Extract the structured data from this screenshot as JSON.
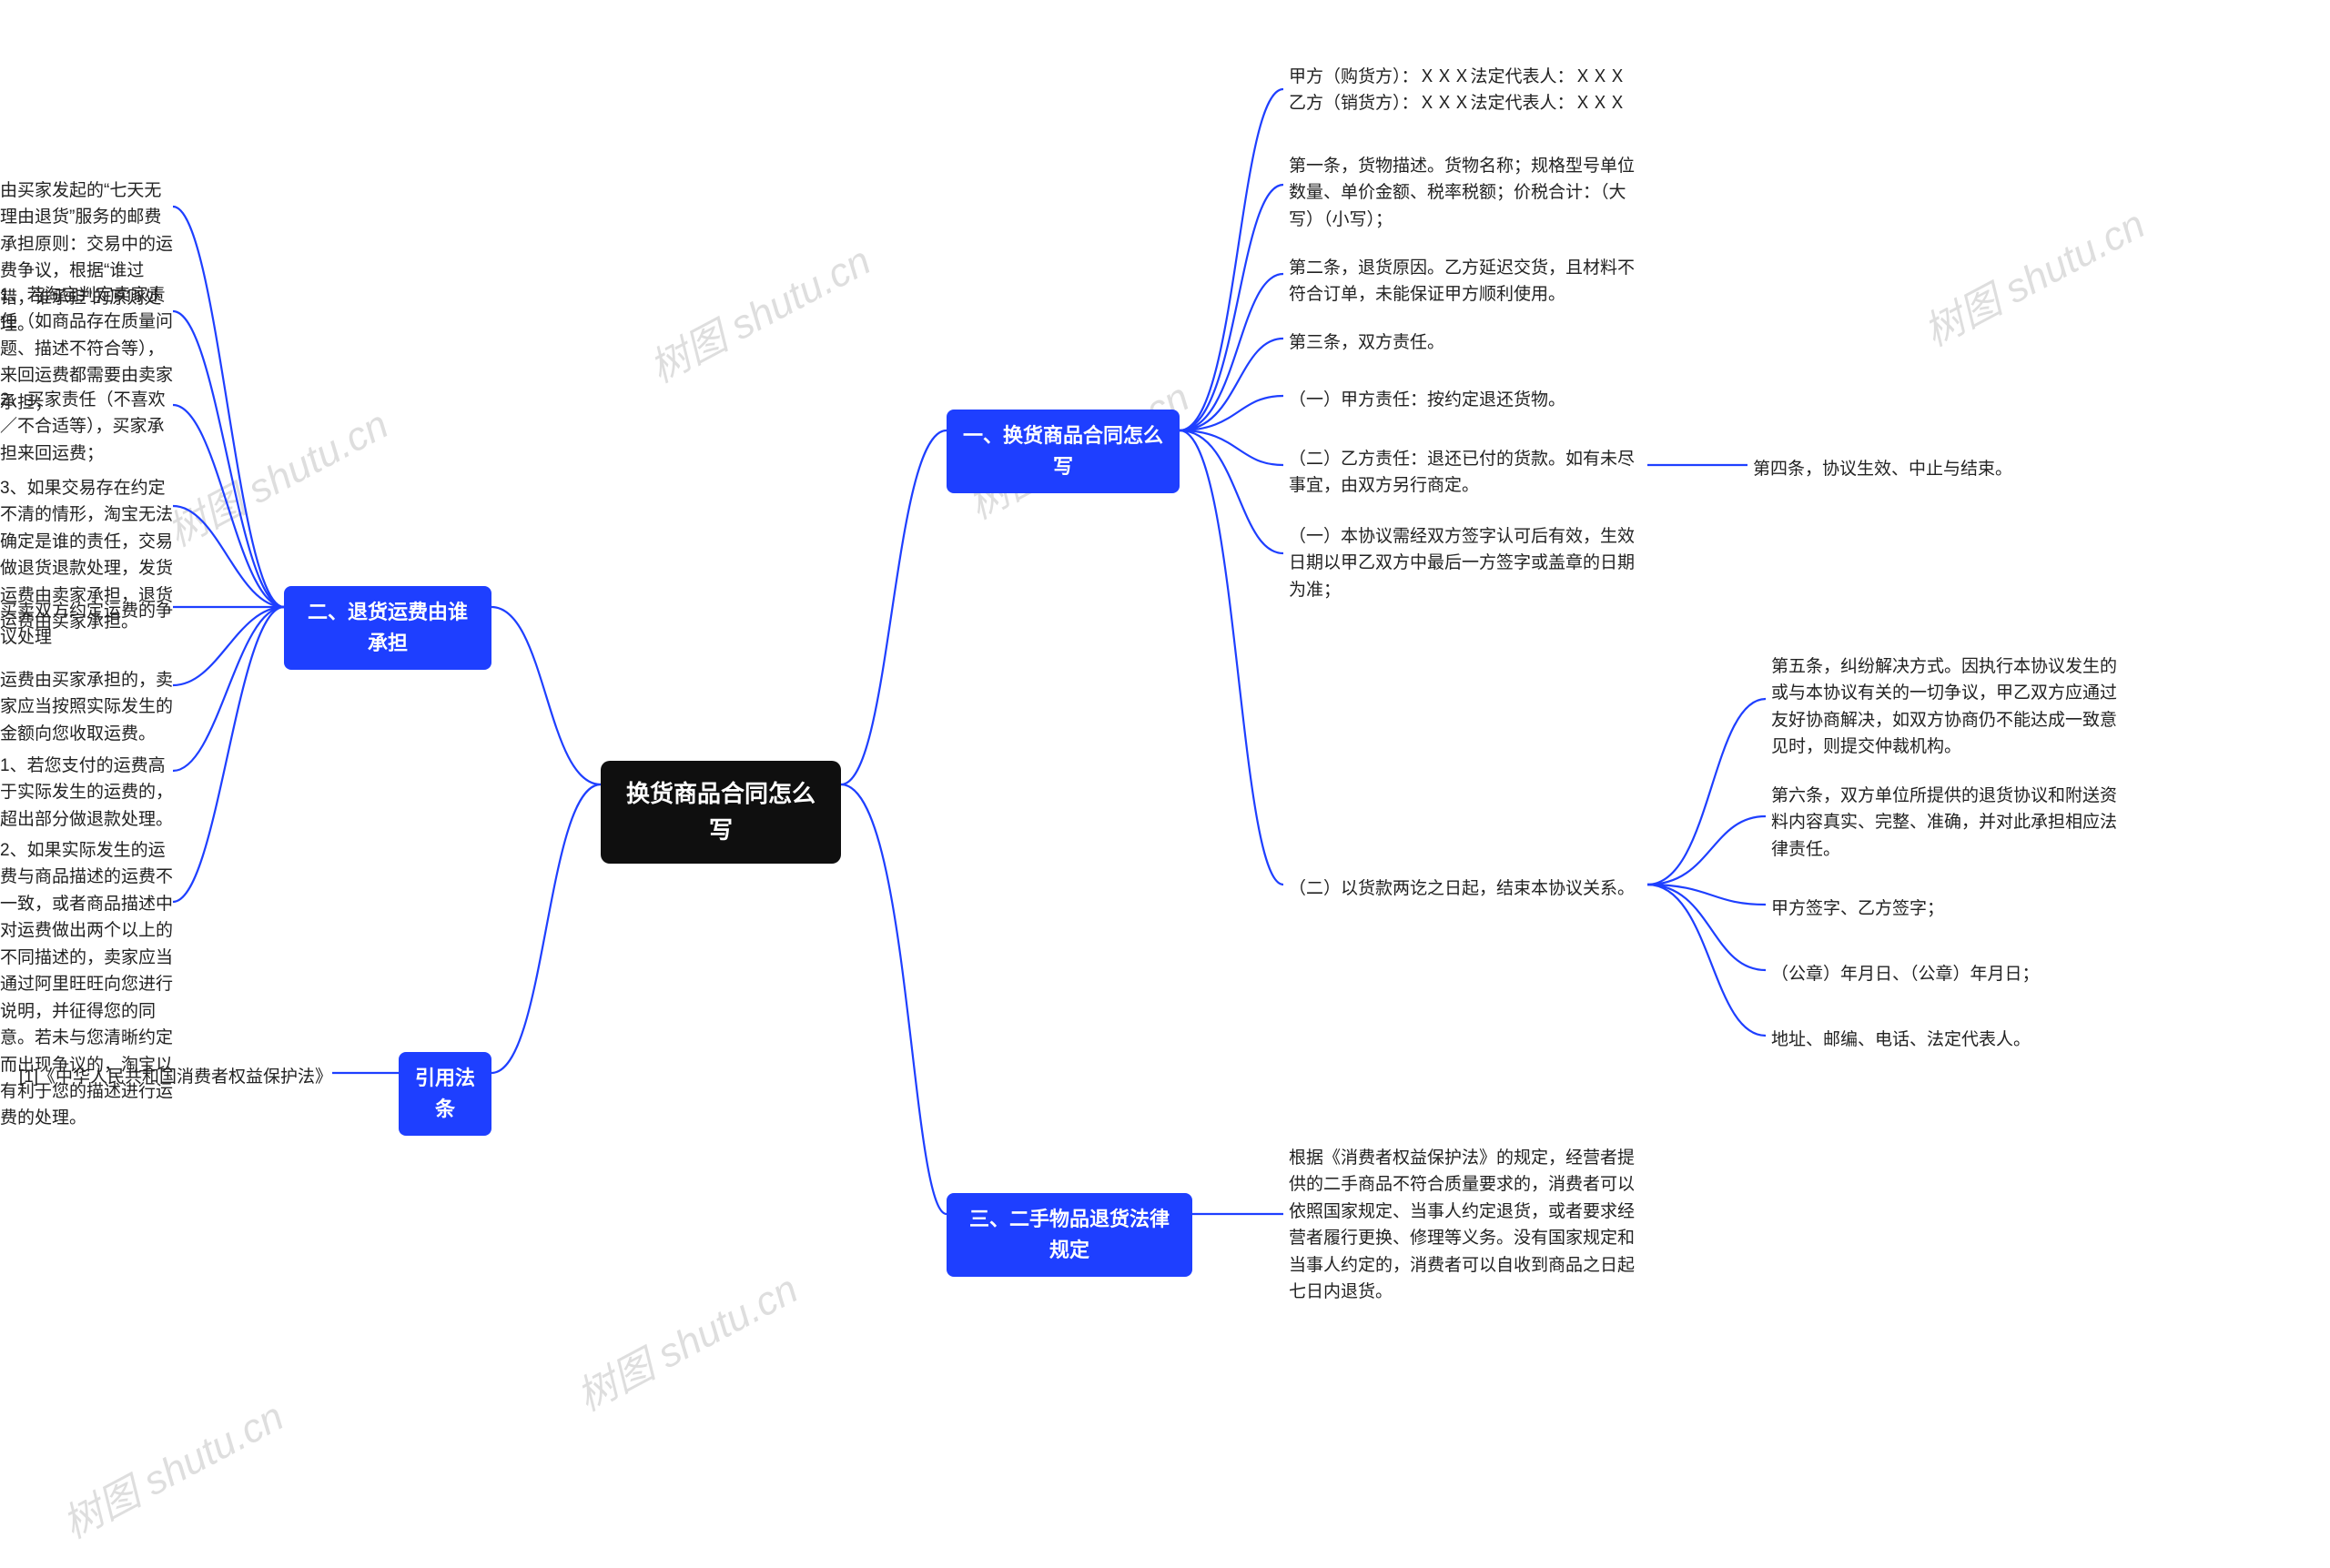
{
  "root": {
    "label": "换货商品合同怎么写"
  },
  "branches": {
    "b1": {
      "label": "一、换货商品合同怎么写"
    },
    "b2": {
      "label": "二、退货运费由谁承担"
    },
    "b3": {
      "label": "三、二手物品退货法律规定"
    },
    "b4": {
      "label": "引用法条"
    }
  },
  "b1_children": {
    "c1": "甲方（购货方）：ＸＸＸ法定代表人：ＸＸＸ\n乙方（销货方）：ＸＸＸ法定代表人：ＸＸＸ",
    "c2": "第一条，货物描述。货物名称；规格型号单位数量、单价金额、税率税额；价税合计：（大写）（小写）；",
    "c3": "第二条，退货原因。乙方延迟交货，且材料不符合订单，未能保证甲方顺利使用。",
    "c4": "第三条，双方责任。",
    "c5": "（一）甲方责任：按约定退还货物。",
    "c6": "（二）乙方责任：退还已付的货款。如有未尽事宜，由双方另行商定。",
    "c6_child": "第四条，协议生效、中止与结束。",
    "c7": "（一）本协议需经双方签字认可后有效，生效日期以甲乙双方中最后一方签字或盖章的日期为准；",
    "c8": "（二）以货款两讫之日起，结束本协议关系。",
    "c8_children": {
      "g1": "第五条，纠纷解决方式。因执行本协议发生的或与本协议有关的一切争议，甲乙双方应通过友好协商解决，如双方协商仍不能达成一致意见时，则提交仲裁机构。",
      "g2": "第六条，双方单位所提供的退货协议和附送资料内容真实、完整、准确，并对此承担相应法律责任。",
      "g3": "甲方签字、乙方签字；",
      "g4": "（公章）年月日、（公章）年月日；",
      "g5": "地址、邮编、电话、法定代表人。"
    }
  },
  "b2_children": {
    "d1": "由买家发起的“七天无理由退货”服务的邮费承担原则：交易中的运费争议，根据“谁过错，谁承担”的原则处理。",
    "d2": "1、若淘宝判定卖家责任（如商品存在质量问题、描述不符合等），来回运费都需要由卖家承担；",
    "d3": "2、买家责任（不喜欢／不合适等），买家承担来回运费；",
    "d4": "3、如果交易存在约定不清的情形，淘宝无法确定是谁的责任，交易做退货退款处理，发货运费由卖家承担，退货运费由买家承担。",
    "d5": "买卖双方约定运费的争议处理",
    "d6": "运费由买家承担的，卖家应当按照实际发生的金额向您收取运费。",
    "d7": "1、若您支付的运费高于实际发生的运费的，超出部分做退款处理。",
    "d8": "2、如果实际发生的运费与商品描述的运费不一致，或者商品描述中对运费做出两个以上的不同描述的，卖家应当通过阿里旺旺向您进行说明，并征得您的同意。若未与您清晰约定而出现争议的，淘宝以有利于您的描述进行运费的处理。"
  },
  "b3_children": {
    "e1": "根据《消费者权益保护法》的规定，经营者提供的二手商品不符合质量要求的，消费者可以依照国家规定、当事人约定退货，或者要求经营者履行更换、修理等义务。没有国家规定和当事人约定的，消费者可以自收到商品之日起七日内退货。"
  },
  "b4_children": {
    "f1": "[1]《中华人民共和国消费者权益保护法》"
  },
  "watermark": "树图 shutu.cn"
}
